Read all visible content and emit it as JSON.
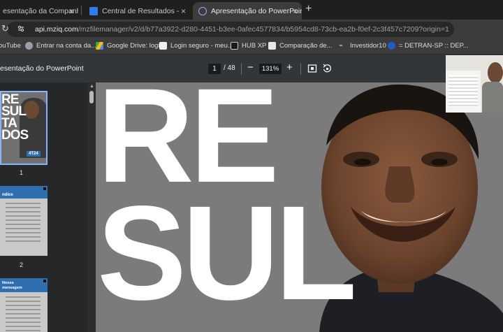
{
  "tabs": [
    {
      "title": "esentação da Companhia -",
      "close": "×",
      "favicon_color": "#4a4a4a"
    },
    {
      "title": "Central de Resultados - Porto S",
      "close": "×",
      "favicon_color": "#2d7cf6"
    },
    {
      "title": "Apresentação do PowerPoint",
      "close": "×",
      "favicon_color": "#8ab4f8"
    }
  ],
  "new_tab": "+",
  "address": {
    "host": "api.mziq.com",
    "path": "/mzfilemanager/v2/d/b77a3922-d280-4451-b3ee-0afec4577834/b5954cd8-73cb-ea2b-f0ef-2c3f457c7209?origin=1"
  },
  "bookmarks": [
    {
      "label": "ouTube",
      "icon_color": "#ff0000"
    },
    {
      "label": "Entrar na conta da...",
      "icon_color": "#9aa0a6"
    },
    {
      "label": "Google Drive: login",
      "icon_color": "#34a853"
    },
    {
      "label": "Login seguro - meu...",
      "icon_color": "#f0f0f0"
    },
    {
      "label": "HUB XP",
      "icon_color": "#1a1a1a"
    },
    {
      "label": "Comparação de...",
      "icon_color": "#e8e8e8"
    },
    {
      "label": "Investidor10",
      "icon_color": "#5f6368"
    },
    {
      "label": "= DETRAN-SP :: DEP...",
      "icon_color": "#1e5bc6"
    }
  ],
  "pdf": {
    "title": "esentação do PowerPoint",
    "page_current": "1",
    "page_total": "/ 48",
    "zoom": "131%",
    "zoom_out": "−",
    "zoom_in": "+"
  },
  "thumbnails": [
    {
      "page": "1",
      "lines": [
        "RE",
        "SUL",
        "TA",
        "DOS"
      ],
      "tag": "4T24"
    },
    {
      "page": "2",
      "header": "ndice"
    },
    {
      "page": "",
      "header": "Nossa",
      "header2": "mensagem"
    }
  ],
  "slide": {
    "line1": "RE",
    "line2": "SUL"
  },
  "colors": {
    "accent": "#8ab4f8",
    "slide_blue": "#2f6fb0",
    "page_bg": "#7b7b7b"
  }
}
